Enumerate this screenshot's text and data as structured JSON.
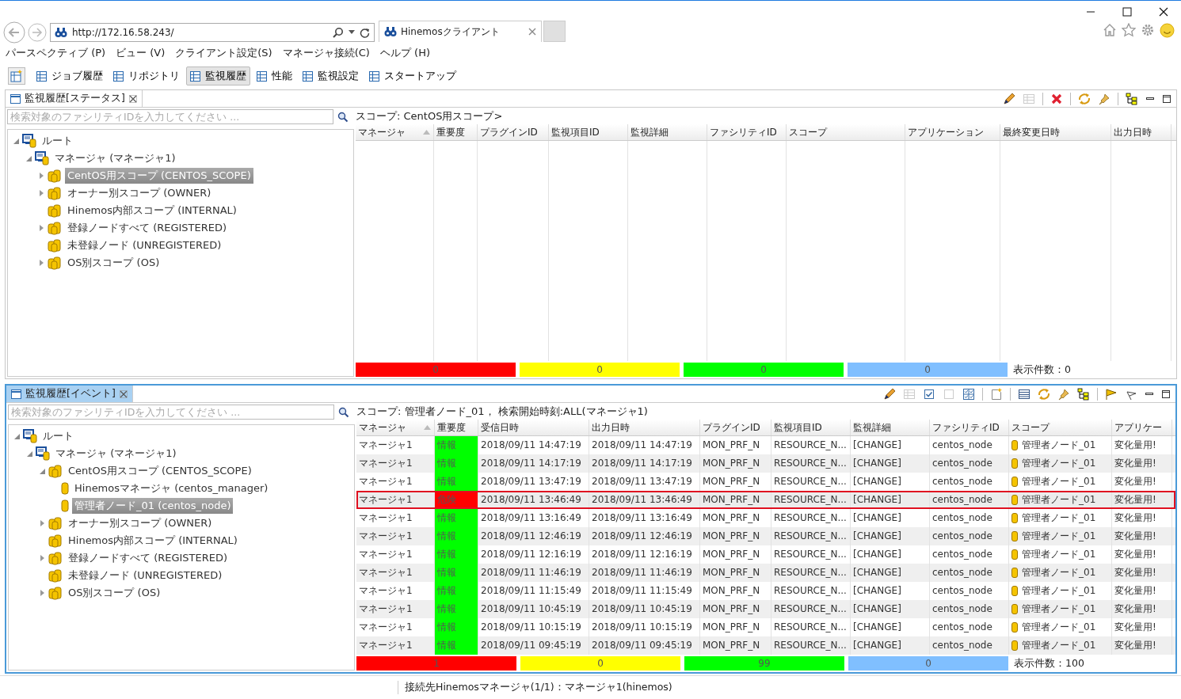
{
  "browser": {
    "address": "http://172.16.58.243/",
    "tab_title": "Hinemosクライアント"
  },
  "menu": [
    "パースペクティブ (P)",
    "ビュー (V)",
    "クライアント設定(S)",
    "マネージャ接続(C)",
    "ヘルプ (H)"
  ],
  "perspectives": [
    {
      "label": "ジョブ履歴",
      "selected": false
    },
    {
      "label": "リポジトリ",
      "selected": false
    },
    {
      "label": "監視履歴",
      "selected": true
    },
    {
      "label": "性能",
      "selected": false
    },
    {
      "label": "監視設定",
      "selected": false
    },
    {
      "label": "スタートアップ",
      "selected": false
    }
  ],
  "views": [
    {
      "title": "監視履歴[ステータス]",
      "active": false,
      "search": {
        "placeholder": "検索対象のファシリティIDを入力してください ..."
      },
      "tree": [
        {
          "label": "ルート",
          "kind": "root",
          "expanded": true,
          "selected": false,
          "children": [
            {
              "label": "マネージャ (マネージャ1)",
              "kind": "root",
              "expanded": true,
              "selected": false,
              "children": [
                {
                  "label": "CentOS用スコープ (CENTOS_SCOPE)",
                  "kind": "scope",
                  "expanded": false,
                  "selected": true
                },
                {
                  "label": "オーナー別スコープ (OWNER)",
                  "kind": "scope",
                  "expanded": false,
                  "selected": false
                },
                {
                  "label": "Hinemos内部スコープ (INTERNAL)",
                  "kind": "scope",
                  "selected": false
                },
                {
                  "label": "登録ノードすべて (REGISTERED)",
                  "kind": "scope",
                  "expanded": false,
                  "selected": false
                },
                {
                  "label": "未登録ノード (UNREGISTERED)",
                  "kind": "scope",
                  "selected": false
                },
                {
                  "label": "OS別スコープ (OS)",
                  "kind": "scope",
                  "expanded": false,
                  "selected": false
                }
              ]
            }
          ]
        }
      ],
      "scope_label": "スコープ: CentOS用スコープ>",
      "columns": [
        {
          "label": "マネージャ",
          "sorted": true
        },
        {
          "label": "重要度",
          "sorted": false
        },
        {
          "label": "プラグインID",
          "sorted": false
        },
        {
          "label": "監視項目ID",
          "sorted": false
        },
        {
          "label": "監視詳細",
          "sorted": false
        },
        {
          "label": "ファシリティID",
          "sorted": false
        },
        {
          "label": "スコープ",
          "sorted": false
        },
        {
          "label": "アプリケーション",
          "sorted": false
        },
        {
          "label": "最終変更日時",
          "sorted": false
        },
        {
          "label": "出力日時",
          "sorted": false
        }
      ],
      "counts": [
        {
          "value": "0",
          "color": "#ff0000"
        },
        {
          "value": "0",
          "color": "#ffff00"
        },
        {
          "value": "0",
          "color": "#00ff00"
        },
        {
          "value": "0",
          "color": "#80bfff"
        }
      ],
      "total": "表示件数：0"
    },
    {
      "title": "監視履歴[イベント]",
      "active": true,
      "search": {
        "placeholder": "検索対象のファシリティIDを入力してください ..."
      },
      "tree": [
        {
          "label": "ルート",
          "kind": "root",
          "expanded": true,
          "selected": false,
          "children": [
            {
              "label": "マネージャ (マネージャ1)",
              "kind": "root",
              "expanded": true,
              "selected": false,
              "children": [
                {
                  "label": "CentOS用スコープ (CENTOS_SCOPE)",
                  "kind": "scope",
                  "expanded": true,
                  "selected": false,
                  "children": [
                    {
                      "label": "Hinemosマネージャ (centos_manager)",
                      "kind": "node",
                      "selected": false
                    },
                    {
                      "label": "管理者ノード_01 (centos_node)",
                      "kind": "node",
                      "selected": true
                    }
                  ]
                },
                {
                  "label": "オーナー別スコープ (OWNER)",
                  "kind": "scope",
                  "expanded": false,
                  "selected": false
                },
                {
                  "label": "Hinemos内部スコープ (INTERNAL)",
                  "kind": "scope",
                  "selected": false
                },
                {
                  "label": "登録ノードすべて (REGISTERED)",
                  "kind": "scope",
                  "expanded": false,
                  "selected": false
                },
                {
                  "label": "未登録ノード (UNREGISTERED)",
                  "kind": "scope",
                  "selected": false
                },
                {
                  "label": "OS別スコープ (OS)",
                  "kind": "scope",
                  "expanded": false,
                  "selected": false
                }
              ]
            }
          ]
        }
      ],
      "scope_label": "スコープ: 管理者ノード_01， 検索開始時刻:ALL(マネージャ1)",
      "columns": [
        {
          "label": "マネージャ",
          "sorted": true
        },
        {
          "label": "重要度",
          "sorted": false
        },
        {
          "label": "受信日時",
          "sorted": false
        },
        {
          "label": "出力日時",
          "sorted": false
        },
        {
          "label": "プラグインID",
          "sorted": false
        },
        {
          "label": "監視項目ID",
          "sorted": false
        },
        {
          "label": "監視詳細",
          "sorted": false
        },
        {
          "label": "ファシリティID",
          "sorted": false
        },
        {
          "label": "スコープ",
          "sorted": false
        },
        {
          "label": "アプリケー",
          "sorted": false
        }
      ],
      "rows": [
        {
          "selected": false,
          "color": "#00ff00",
          "cells": [
            "マネージャ1",
            "情報",
            "2018/09/11 14:47:19",
            "2018/09/11 14:47:19",
            "MON_PRF_N",
            "RESOURCE_N...",
            "[CHANGE]",
            "centos_node",
            "管理者ノード_01",
            "変化量用!"
          ]
        },
        {
          "selected": false,
          "color": "#00ff00",
          "cells": [
            "マネージャ1",
            "情報",
            "2018/09/11 14:17:19",
            "2018/09/11 14:17:19",
            "MON_PRF_N",
            "RESOURCE_N...",
            "[CHANGE]",
            "centos_node",
            "管理者ノード_01",
            "変化量用!"
          ]
        },
        {
          "selected": false,
          "color": "#00ff00",
          "cells": [
            "マネージャ1",
            "情報",
            "2018/09/11 13:47:19",
            "2018/09/11 13:47:19",
            "MON_PRF_N",
            "RESOURCE_N...",
            "[CHANGE]",
            "centos_node",
            "管理者ノード_01",
            "変化量用!"
          ]
        },
        {
          "selected": true,
          "color": "#ff0000",
          "cells": [
            "マネージャ1",
            "危険",
            "2018/09/11 13:46:49",
            "2018/09/11 13:46:49",
            "MON_PRF_N",
            "RESOURCE_N...",
            "[CHANGE]",
            "centos_node",
            "管理者ノード_01",
            "変化量用!"
          ]
        },
        {
          "selected": false,
          "color": "#00ff00",
          "cells": [
            "マネージャ1",
            "情報",
            "2018/09/11 13:16:49",
            "2018/09/11 13:16:49",
            "MON_PRF_N",
            "RESOURCE_N...",
            "[CHANGE]",
            "centos_node",
            "管理者ノード_01",
            "変化量用!"
          ]
        },
        {
          "selected": false,
          "color": "#00ff00",
          "cells": [
            "マネージャ1",
            "情報",
            "2018/09/11 12:46:19",
            "2018/09/11 12:46:19",
            "MON_PRF_N",
            "RESOURCE_N...",
            "[CHANGE]",
            "centos_node",
            "管理者ノード_01",
            "変化量用!"
          ]
        },
        {
          "selected": false,
          "color": "#00ff00",
          "cells": [
            "マネージャ1",
            "情報",
            "2018/09/11 12:16:19",
            "2018/09/11 12:16:19",
            "MON_PRF_N",
            "RESOURCE_N...",
            "[CHANGE]",
            "centos_node",
            "管理者ノード_01",
            "変化量用!"
          ]
        },
        {
          "selected": false,
          "color": "#00ff00",
          "cells": [
            "マネージャ1",
            "情報",
            "2018/09/11 11:46:19",
            "2018/09/11 11:46:19",
            "MON_PRF_N",
            "RESOURCE_N...",
            "[CHANGE]",
            "centos_node",
            "管理者ノード_01",
            "変化量用!"
          ]
        },
        {
          "selected": false,
          "color": "#00ff00",
          "cells": [
            "マネージャ1",
            "情報",
            "2018/09/11 11:15:49",
            "2018/09/11 11:15:49",
            "MON_PRF_N",
            "RESOURCE_N...",
            "[CHANGE]",
            "centos_node",
            "管理者ノード_01",
            "変化量用!"
          ]
        },
        {
          "selected": false,
          "color": "#00ff00",
          "cells": [
            "マネージャ1",
            "情報",
            "2018/09/11 10:45:19",
            "2018/09/11 10:45:19",
            "MON_PRF_N",
            "RESOURCE_N...",
            "[CHANGE]",
            "centos_node",
            "管理者ノード_01",
            "変化量用!"
          ]
        },
        {
          "selected": false,
          "color": "#00ff00",
          "cells": [
            "マネージャ1",
            "情報",
            "2018/09/11 10:15:19",
            "2018/09/11 10:15:19",
            "MON_PRF_N",
            "RESOURCE_N...",
            "[CHANGE]",
            "centos_node",
            "管理者ノード_01",
            "変化量用!"
          ]
        },
        {
          "selected": false,
          "color": "#00ff00",
          "cells": [
            "マネージャ1",
            "情報",
            "2018/09/11 09:45:19",
            "2018/09/11 09:45:19",
            "MON_PRF_N",
            "RESOURCE_N...",
            "[CHANGE]",
            "centos_node",
            "管理者ノード_01",
            "変化量用!"
          ]
        }
      ],
      "counts": [
        {
          "value": "1",
          "color": "#ff0000"
        },
        {
          "value": "0",
          "color": "#ffff00"
        },
        {
          "value": "99",
          "color": "#00ff00"
        },
        {
          "value": "0",
          "color": "#80bfff"
        }
      ],
      "total": "表示件数：100"
    }
  ],
  "status": "接続先Hinemosマネージャ(1/1)：マネージャ1(hinemos)"
}
